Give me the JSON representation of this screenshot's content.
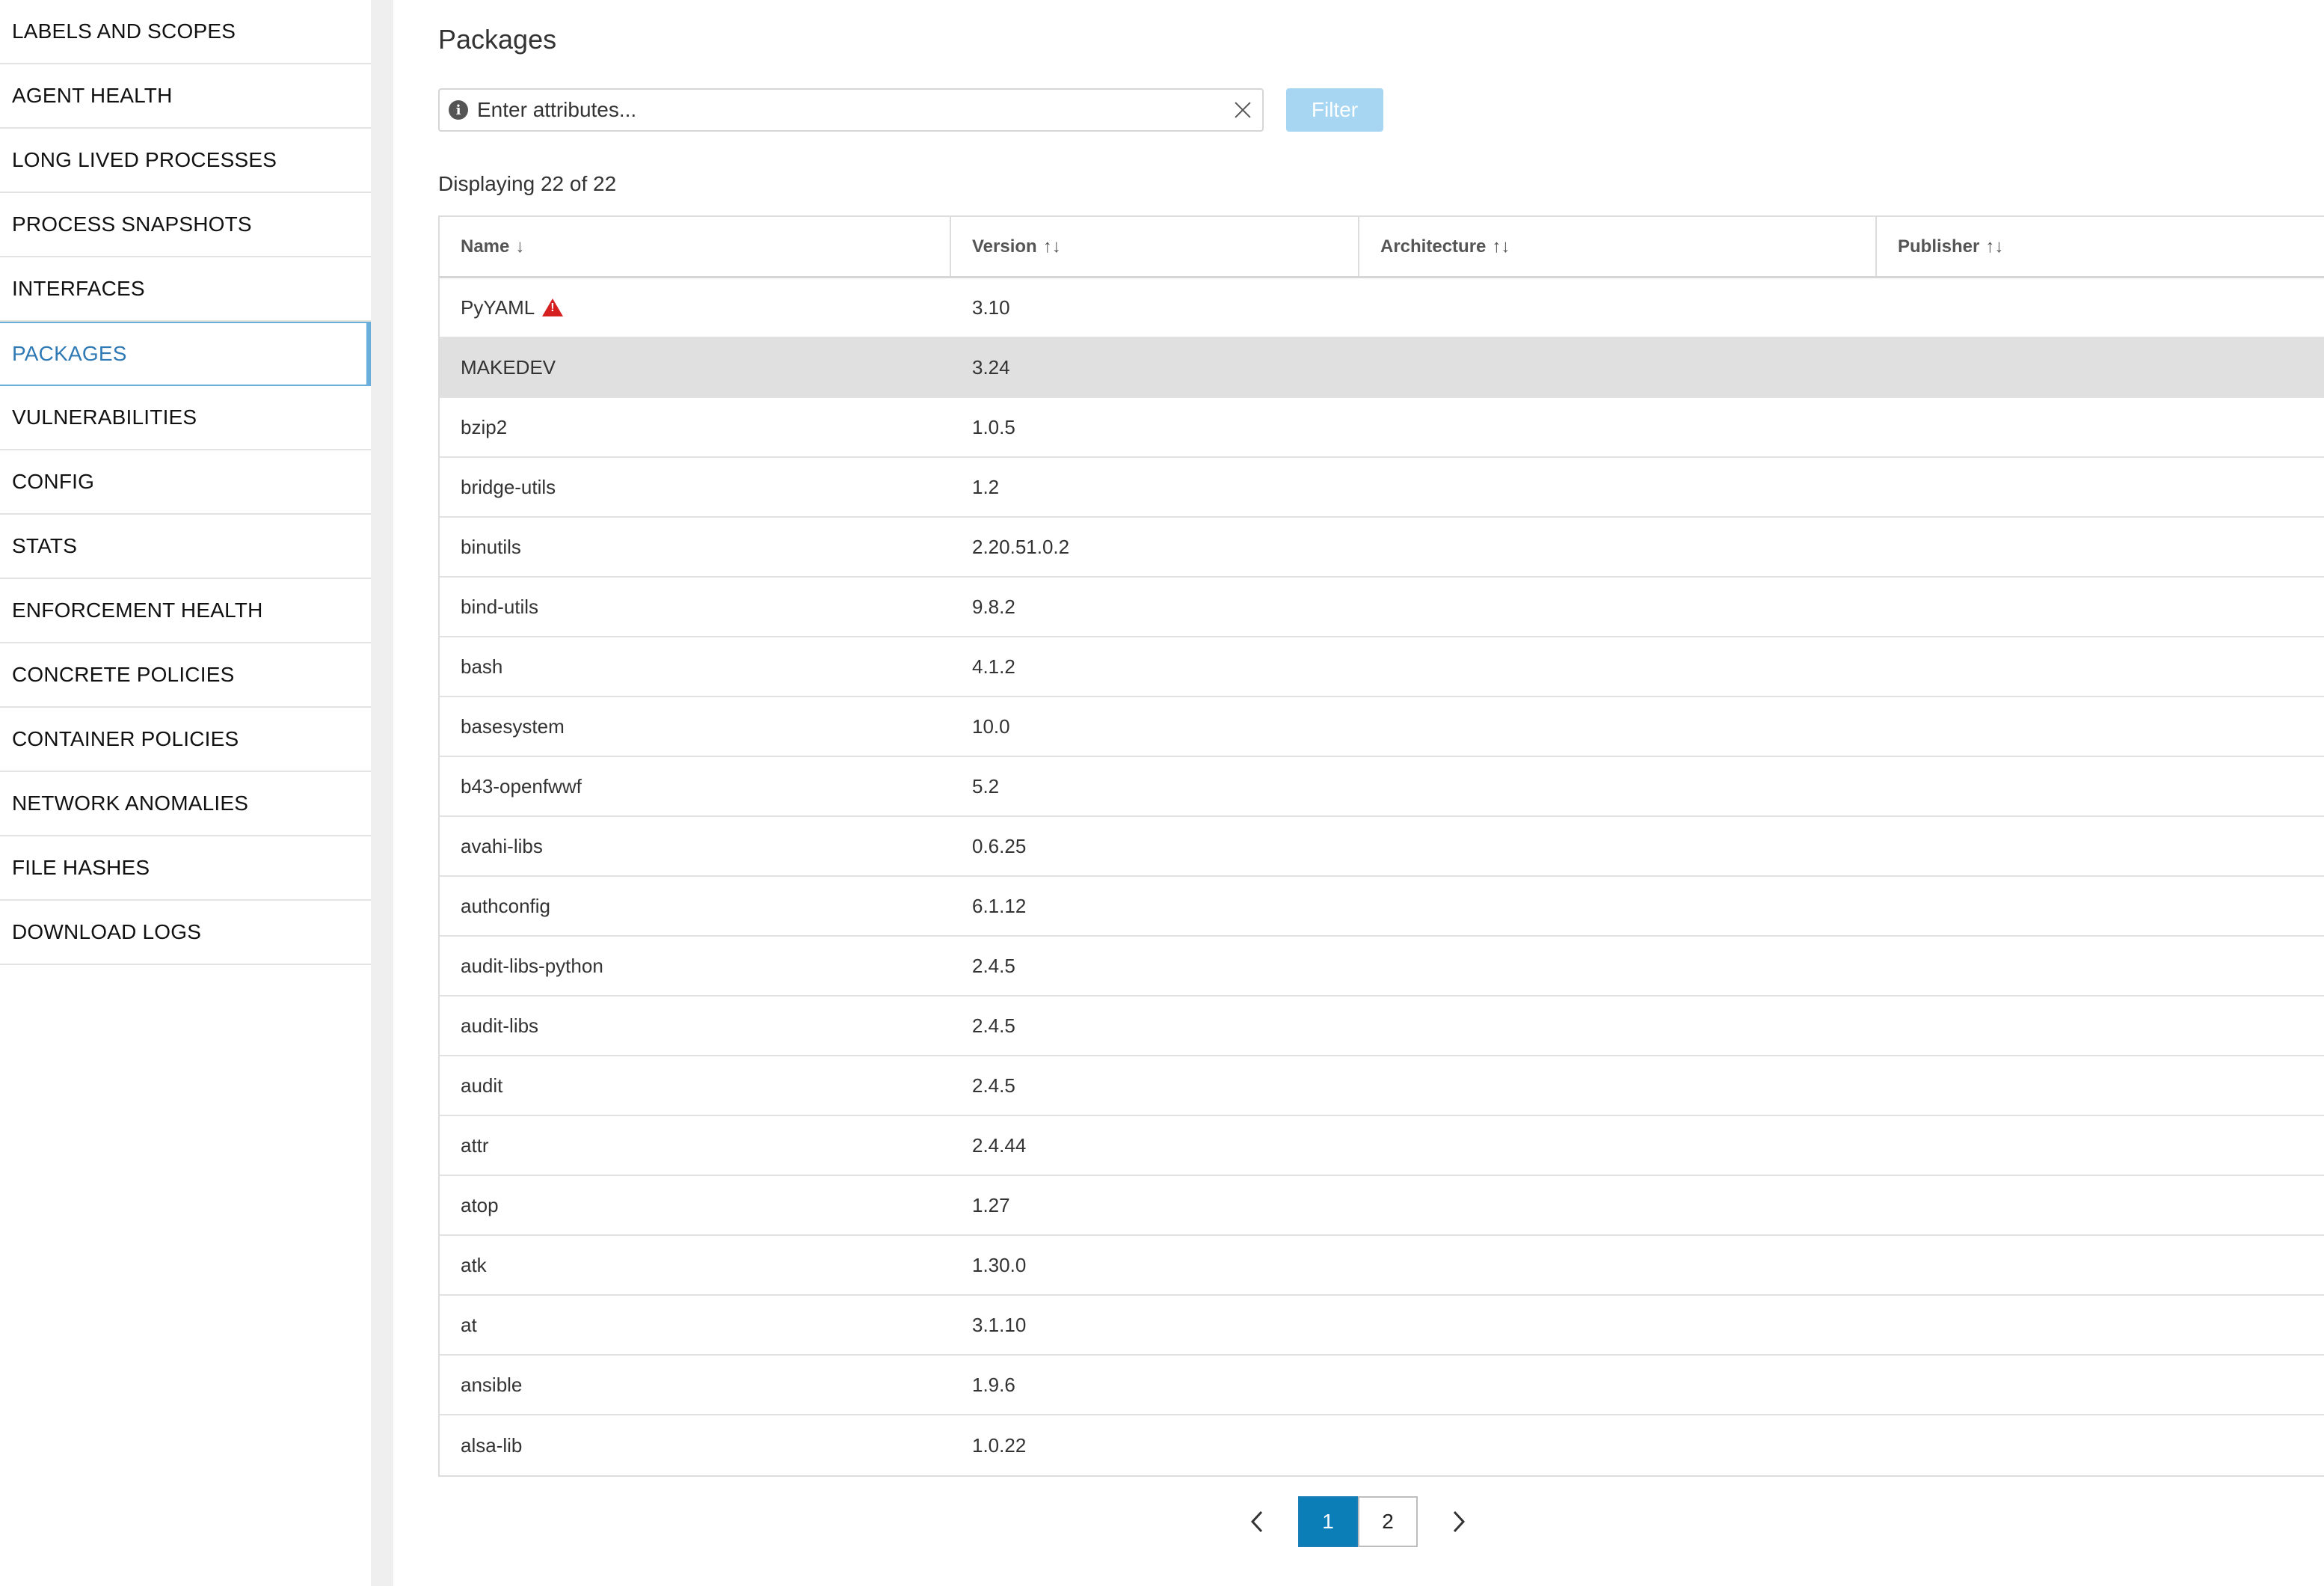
{
  "sidebar": {
    "items": [
      {
        "label": "LABELS AND SCOPES",
        "active": false
      },
      {
        "label": "AGENT HEALTH",
        "active": false
      },
      {
        "label": "LONG LIVED PROCESSES",
        "active": false
      },
      {
        "label": "PROCESS SNAPSHOTS",
        "active": false
      },
      {
        "label": "INTERFACES",
        "active": false
      },
      {
        "label": "PACKAGES",
        "active": true
      },
      {
        "label": "VULNERABILITIES",
        "active": false
      },
      {
        "label": "CONFIG",
        "active": false
      },
      {
        "label": "STATS",
        "active": false
      },
      {
        "label": "ENFORCEMENT HEALTH",
        "active": false
      },
      {
        "label": "CONCRETE POLICIES",
        "active": false
      },
      {
        "label": "CONTAINER POLICIES",
        "active": false
      },
      {
        "label": "NETWORK ANOMALIES",
        "active": false
      },
      {
        "label": "FILE HASHES",
        "active": false
      },
      {
        "label": "DOWNLOAD LOGS",
        "active": false
      }
    ]
  },
  "main": {
    "title": "Packages",
    "filter": {
      "placeholder": "Enter attributes...",
      "value": "",
      "button_label": "Filter",
      "info_glyph": "i"
    },
    "count_text": "Displaying 22 of 22",
    "table": {
      "columns": [
        {
          "label": "Name",
          "sort": "↓"
        },
        {
          "label": "Version",
          "sort": "↑↓"
        },
        {
          "label": "Architecture",
          "sort": "↑↓"
        },
        {
          "label": "Publisher",
          "sort": "↑↓"
        }
      ],
      "rows": [
        {
          "name": "PyYAML",
          "version": "3.10",
          "architecture": "",
          "publisher": "",
          "warning": true
        },
        {
          "name": "MAKEDEV",
          "version": "3.24",
          "architecture": "",
          "publisher": "",
          "selected": true
        },
        {
          "name": "bzip2",
          "version": "1.0.5",
          "architecture": "",
          "publisher": ""
        },
        {
          "name": "bridge-utils",
          "version": "1.2",
          "architecture": "",
          "publisher": ""
        },
        {
          "name": "binutils",
          "version": "2.20.51.0.2",
          "architecture": "",
          "publisher": ""
        },
        {
          "name": "bind-utils",
          "version": "9.8.2",
          "architecture": "",
          "publisher": ""
        },
        {
          "name": "bash",
          "version": "4.1.2",
          "architecture": "",
          "publisher": ""
        },
        {
          "name": "basesystem",
          "version": "10.0",
          "architecture": "",
          "publisher": ""
        },
        {
          "name": "b43-openfwwf",
          "version": "5.2",
          "architecture": "",
          "publisher": ""
        },
        {
          "name": "avahi-libs",
          "version": "0.6.25",
          "architecture": "",
          "publisher": ""
        },
        {
          "name": "authconfig",
          "version": "6.1.12",
          "architecture": "",
          "publisher": ""
        },
        {
          "name": "audit-libs-python",
          "version": "2.4.5",
          "architecture": "",
          "publisher": ""
        },
        {
          "name": "audit-libs",
          "version": "2.4.5",
          "architecture": "",
          "publisher": ""
        },
        {
          "name": "audit",
          "version": "2.4.5",
          "architecture": "",
          "publisher": ""
        },
        {
          "name": "attr",
          "version": "2.4.44",
          "architecture": "",
          "publisher": ""
        },
        {
          "name": "atop",
          "version": "1.27",
          "architecture": "",
          "publisher": ""
        },
        {
          "name": "atk",
          "version": "1.30.0",
          "architecture": "",
          "publisher": ""
        },
        {
          "name": "at",
          "version": "3.1.10",
          "architecture": "",
          "publisher": ""
        },
        {
          "name": "ansible",
          "version": "1.9.6",
          "architecture": "",
          "publisher": ""
        },
        {
          "name": "alsa-lib",
          "version": "1.0.22",
          "architecture": "",
          "publisher": ""
        }
      ]
    },
    "pagination": {
      "pages": [
        {
          "label": "1",
          "active": true
        },
        {
          "label": "2",
          "active": false
        }
      ]
    }
  },
  "colors": {
    "accent": "#0b7eb8",
    "active_nav": "#2f7ab5",
    "filter_button": "#a7d6f2",
    "warning": "#d61f1f",
    "selected_row": "#e0e0e0"
  }
}
